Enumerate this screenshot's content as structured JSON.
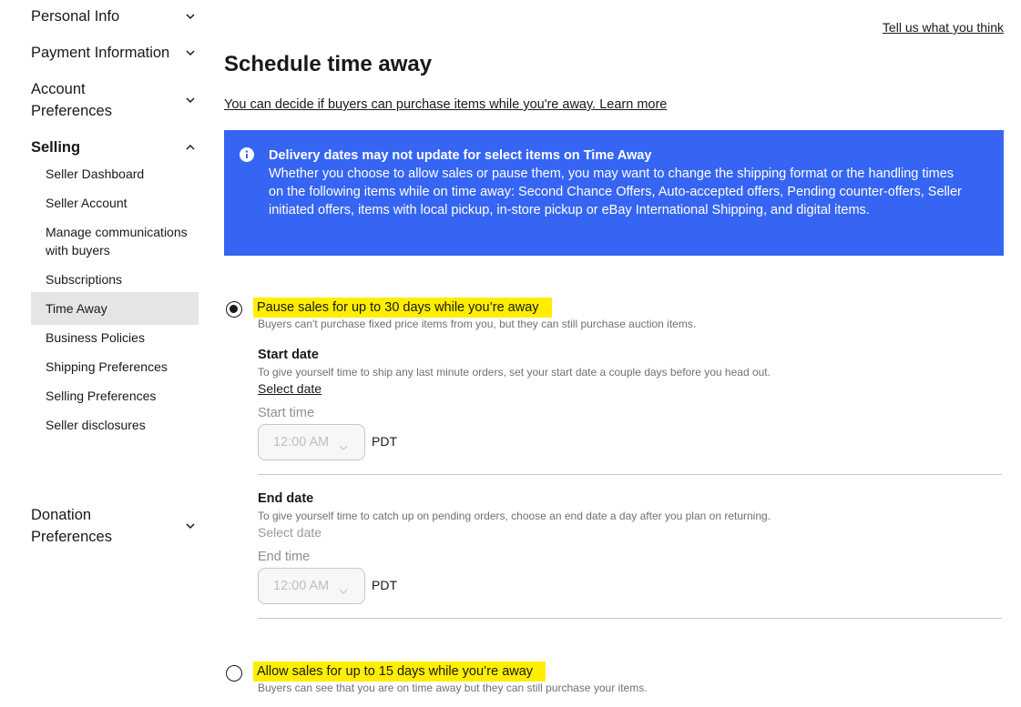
{
  "header": {
    "feedback_link": "Tell us what you think"
  },
  "sidebar": {
    "sections": [
      {
        "label": "Personal Info",
        "expanded": false
      },
      {
        "label": "Payment Information",
        "expanded": false
      },
      {
        "label": "Account Preferences",
        "expanded": false
      },
      {
        "label": "Selling",
        "expanded": true
      },
      {
        "label": "Donation Preferences",
        "expanded": false
      }
    ],
    "selling_items": [
      {
        "label": "Seller Dashboard",
        "active": false
      },
      {
        "label": "Seller Account",
        "active": false
      },
      {
        "label": "Manage communications with buyers",
        "active": false
      },
      {
        "label": "Subscriptions",
        "active": false
      },
      {
        "label": "Time Away",
        "active": true
      },
      {
        "label": "Business Policies",
        "active": false
      },
      {
        "label": "Shipping Preferences",
        "active": false
      },
      {
        "label": "Selling Preferences",
        "active": false
      },
      {
        "label": "Seller disclosures",
        "active": false
      }
    ]
  },
  "main": {
    "title": "Schedule time away",
    "learn_more_link": "You can decide if buyers can purchase items while you're away. Learn more",
    "banner": {
      "icon": "info-icon",
      "title": "Delivery dates may not update for select items on Time Away",
      "text": "Whether you choose to allow sales or pause them, you may want to change the shipping format or the handling times on the following items while on time away: Second Chance Offers, Auto-accepted offers, Pending counter-offers, Seller initiated offers, items with local pickup, in-store pickup or eBay International Shipping, and digital items.",
      "background": "#3665f3"
    },
    "options": [
      {
        "title": "Pause sales for up to 30 days while you’re away",
        "description": "Buyers can't purchase fixed price items from you, but they can still purchase auction items.",
        "selected": true
      },
      {
        "title": "Allow sales for up to 15 days while you’re away",
        "description": "Buyers can see that you are on time away but they can still purchase your items.",
        "selected": false
      }
    ],
    "start": {
      "label": "Start date",
      "help": "To give yourself time to ship any last minute orders, set your start date a couple days before you head out.",
      "select_date": "Select date",
      "time_label": "Start time",
      "time_value": "12:00 AM",
      "timezone": "PDT"
    },
    "end": {
      "label": "End date",
      "help": "To give yourself time to catch up on pending orders, choose an end date a day after you plan on returning.",
      "select_date": "Select date",
      "time_label": "End time",
      "time_value": "12:00 AM",
      "timezone": "PDT"
    },
    "highlight_color": "#ffee00"
  }
}
